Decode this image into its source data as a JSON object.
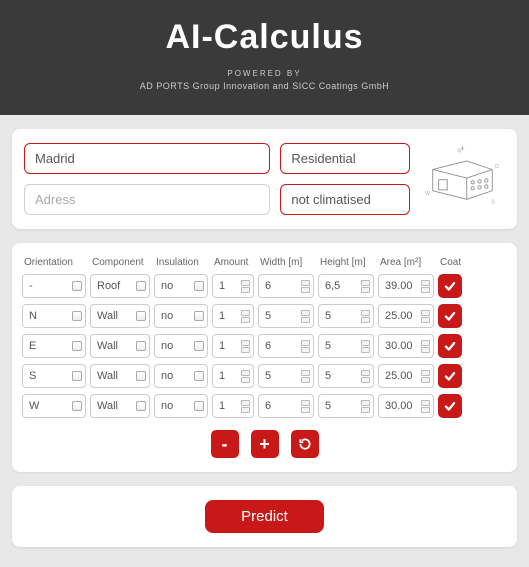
{
  "header": {
    "title": "AI-Calculus",
    "powered_by": "POWERED BY",
    "companies": "AD PORTS Group Innovation and SICC Coatings GmbH"
  },
  "top": {
    "city": "Madrid",
    "address_placeholder": "Adress",
    "building_type": "Residential",
    "climate": "not climatised"
  },
  "table": {
    "headers": {
      "orientation": "Orientation",
      "component": "Component",
      "insulation": "Insulation",
      "amount": "Amount",
      "width": "Width [m]",
      "height": "Height [m]",
      "area": "Area [m²]",
      "coat": "Coat"
    },
    "rows": [
      {
        "orientation": "-",
        "component": "Roof",
        "insulation": "no",
        "amount": "1",
        "width": "6",
        "height": "6,5",
        "area": "39.00",
        "coat": true
      },
      {
        "orientation": "N",
        "component": "Wall",
        "insulation": "no",
        "amount": "1",
        "width": "5",
        "height": "5",
        "area": "25.00",
        "coat": true
      },
      {
        "orientation": "E",
        "component": "Wall",
        "insulation": "no",
        "amount": "1",
        "width": "6",
        "height": "5",
        "area": "30.00",
        "coat": true
      },
      {
        "orientation": "S",
        "component": "Wall",
        "insulation": "no",
        "amount": "1",
        "width": "5",
        "height": "5",
        "area": "25.00",
        "coat": true
      },
      {
        "orientation": "W",
        "component": "Wall",
        "insulation": "no",
        "amount": "1",
        "width": "6",
        "height": "5",
        "area": "30.00",
        "coat": true
      }
    ],
    "controls": {
      "remove": "-",
      "add": "+",
      "reset": "↺"
    }
  },
  "predict": {
    "label": "Predict"
  }
}
